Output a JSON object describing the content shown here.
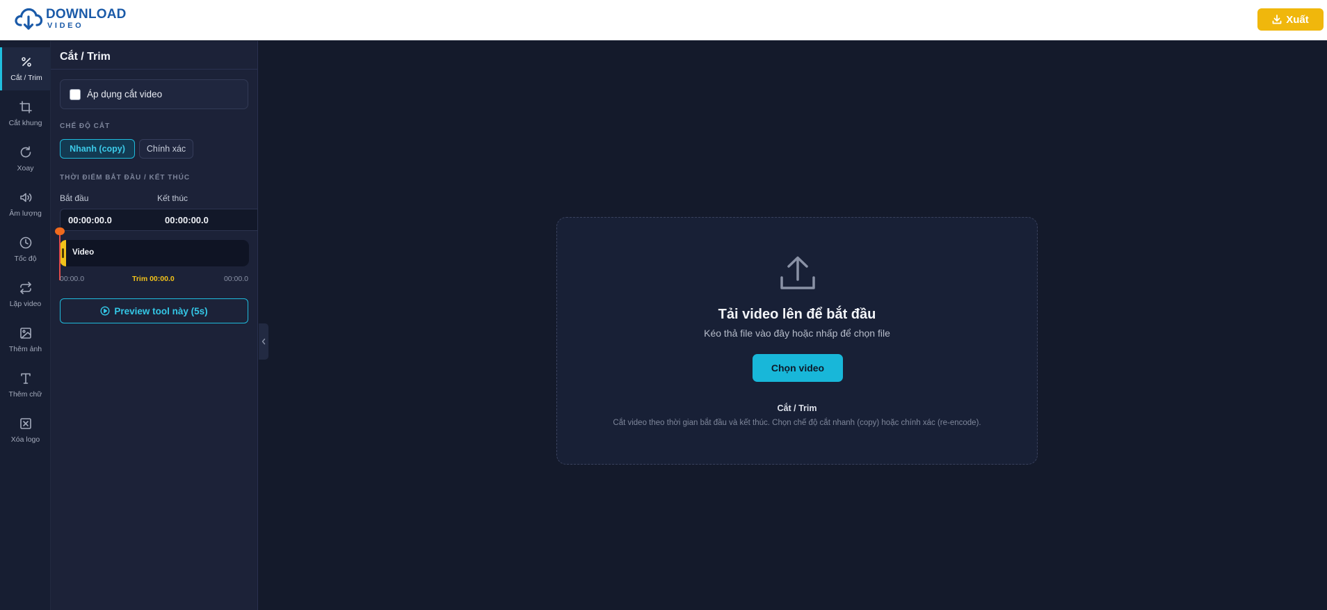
{
  "header": {
    "logo_line1": "DOWNLOAD",
    "logo_line2": "VIDEO",
    "export_label": "Xuất",
    "brand_color": "#1a5aa8",
    "export_color": "#f0b70c"
  },
  "rail": {
    "items": [
      {
        "label": "Cắt / Trim",
        "icon": "percent-icon",
        "active": true
      },
      {
        "label": "Cắt khung",
        "icon": "crop-icon",
        "active": false
      },
      {
        "label": "Xoay",
        "icon": "rotate-icon",
        "active": false
      },
      {
        "label": "Âm lượng",
        "icon": "volume-icon",
        "active": false
      },
      {
        "label": "Tốc độ",
        "icon": "clock-icon",
        "active": false
      },
      {
        "label": "Lặp video",
        "icon": "repeat-icon",
        "active": false
      },
      {
        "label": "Thêm ảnh",
        "icon": "image-icon",
        "active": false
      },
      {
        "label": "Thêm chữ",
        "icon": "text-icon",
        "active": false
      },
      {
        "label": "Xóa logo",
        "icon": "remove-box-icon",
        "active": false
      }
    ]
  },
  "panel": {
    "title": "Cắt / Trim",
    "apply_label": "Áp dụng cắt video",
    "apply_checked": false,
    "mode_section": "CHẾ ĐỘ CẮT",
    "mode_fast": "Nhanh (copy)",
    "mode_exact": "Chính xác",
    "time_section": "THỜI ĐIỂM BẮT ĐẦU / KẾT THÚC",
    "start_label": "Bắt đầu",
    "end_label": "Kết thúc",
    "start_value": "00:00:00.0",
    "end_value": "00:00:00.0",
    "track_label": "Video",
    "time_start": "00:00.0",
    "trim_text": "Trim 00:00.0",
    "time_end": "00:00.0",
    "preview_label": "Preview tool này (5s)",
    "accent_color": "#1fbcdd"
  },
  "dropzone": {
    "title": "Tải video lên để bắt đầu",
    "subtitle": "Kéo thả file vào đây hoặc nhấp để chọn file",
    "button": "Chọn video",
    "tool_title": "Cắt / Trim",
    "tool_desc": "Cắt video theo thời gian bắt đầu và kết thúc. Chọn chế độ cắt nhanh (copy) hoặc chính xác (re-encode)."
  }
}
